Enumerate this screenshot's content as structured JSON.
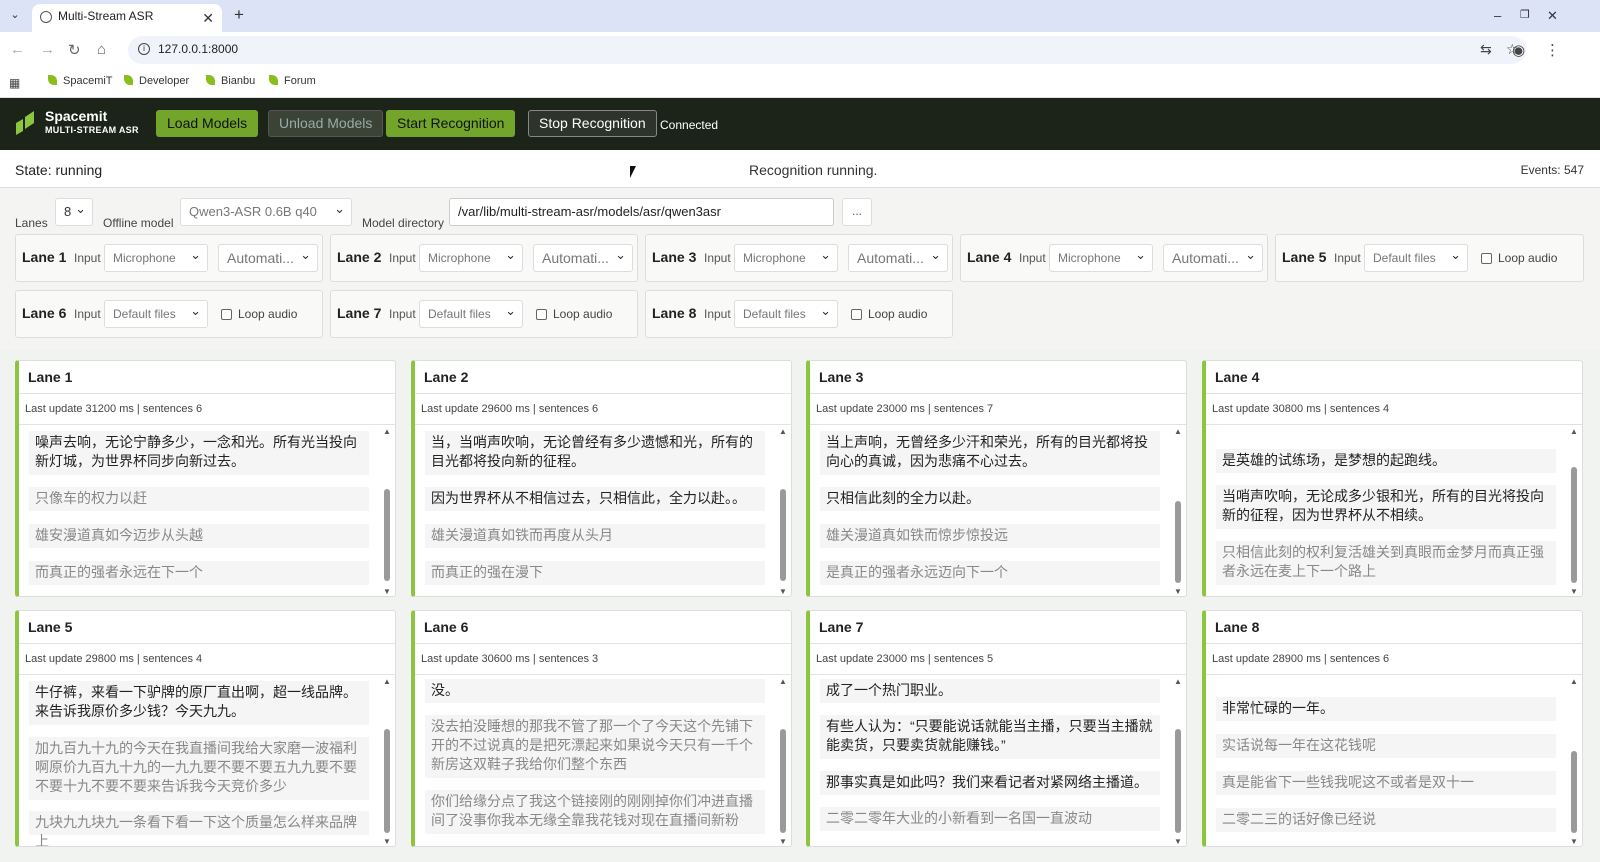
{
  "browser": {
    "tab_title": "Multi-Stream ASR",
    "url": "127.0.0.1:8000",
    "bookmarks": [
      "SpacemiT",
      "Developer",
      "Bianbu",
      "Forum"
    ]
  },
  "header": {
    "brand": "Spacemit",
    "brand_sub": "MULTI-STREAM ASR",
    "buttons": {
      "load": "Load Models",
      "unload": "Unload Models",
      "start": "Start Recognition",
      "stop": "Stop Recognition"
    },
    "connection": "Connected"
  },
  "status": {
    "state": "State: running",
    "message": "Recognition running.",
    "events": "Events: 547"
  },
  "config": {
    "lanes_label": "Lanes",
    "lanes_value": "8",
    "offline_model_label": "Offline model",
    "offline_model_value": "Qwen3-ASR 0.6B q40",
    "model_dir_label": "Model directory",
    "model_dir_value": "/var/lib/multi-stream-asr/models/asr/qwen3asr",
    "browse": "...",
    "input_label": "Input",
    "loop_label": "Loop audio",
    "lane_controls": [
      {
        "title": "Lane 1",
        "input": "Microphone",
        "mode": "Automati..."
      },
      {
        "title": "Lane 2",
        "input": "Microphone",
        "mode": "Automati..."
      },
      {
        "title": "Lane 3",
        "input": "Microphone",
        "mode": "Automati..."
      },
      {
        "title": "Lane 4",
        "input": "Microphone",
        "mode": "Automati..."
      },
      {
        "title": "Lane 5",
        "input": "Default files"
      },
      {
        "title": "Lane 6",
        "input": "Default files"
      },
      {
        "title": "Lane 7",
        "input": "Default files"
      },
      {
        "title": "Lane 8",
        "input": "Default files"
      }
    ]
  },
  "lanes": [
    {
      "title": "Lane 1",
      "meta": "Last update 31200 ms | sentences 6",
      "segments": [
        {
          "text": "噪声去响，无论宁静多少，一念和光。所有光当投向新灯城，为世界杯同步向新过去。",
          "final": true
        },
        {
          "text": "只像车的权力以赶",
          "final": false
        },
        {
          "text": "雄安漫道真如今迈步从头越",
          "final": false
        },
        {
          "text": "而真正的强者永远在下一个",
          "final": false
        }
      ]
    },
    {
      "title": "Lane 2",
      "meta": "Last update 29600 ms | sentences 6",
      "segments": [
        {
          "text": "当，当哨声吹响，无论曾经有多少遗憾和光，所有的目光都将投向新的征程。",
          "final": true
        },
        {
          "text": "因为世界杯从不相信过去，只相信此，全力以赴。。",
          "final": true
        },
        {
          "text": "雄关漫道真如铁而再度从头月",
          "final": false
        },
        {
          "text": "而真正的强在漫下",
          "final": false
        }
      ]
    },
    {
      "title": "Lane 3",
      "meta": "Last update 23000 ms | sentences 7",
      "segments": [
        {
          "text": "当上声响，无曾经多少汗和荣光，所有的目光都将投向心的真诚，因为悲痛不心过去。",
          "final": true
        },
        {
          "text": "只相信此刻的全力以赴。",
          "final": true
        },
        {
          "text": "雄关漫道真如铁而惊步惊投远",
          "final": false
        },
        {
          "text": "是真正的强者永远迈向下一个",
          "final": false
        }
      ]
    },
    {
      "title": "Lane 4",
      "meta": "Last update 30800 ms | sentences 4",
      "segments": [
        {
          "text": "是英雄的试练场，是梦想的起跑线。",
          "final": true
        },
        {
          "text": "当哨声吹响，无论成多少银和光，所有的目光将投向新的征程，因为世界杯从不相续。",
          "final": true
        },
        {
          "text": "只相信此刻的权利复活雄关到真眼而金梦月而真正强者永远在麦上下一个路上",
          "final": false
        }
      ]
    },
    {
      "title": "Lane 5",
      "meta": "Last update 29800 ms | sentences 4",
      "segments": [
        {
          "text": "牛仔裤，来看一下驴牌的原厂直出啊，超一线品牌。来告诉我原价多少钱？今天九九。",
          "final": true
        },
        {
          "text": "加九百九十九的今天在我直播间我给大家磨一波福利啊原价九百九十九的一九九要不要不要五九九要不要不要十九不要不要来告诉我今天竞价多少",
          "final": false
        },
        {
          "text": "九块九九块九一条看下看一下这个质量怎么样来品牌上",
          "final": false
        }
      ]
    },
    {
      "title": "Lane 6",
      "meta": "Last update 30600 ms | sentences 3",
      "segments": [
        {
          "text": "没。",
          "final": true
        },
        {
          "text": "没去拍没睡想的那我不管了那一个了今天这个先铺下开的不过说真的是把死漂起来如果说今天只有一千个新房这双鞋子我给你们整个东西",
          "final": false
        },
        {
          "text": "你们给缘分点了我这个链接刚的刚刚掉你们冲进直播间了没事你我本无缘全靠我花钱对现在直播间新粉",
          "final": false
        }
      ]
    },
    {
      "title": "Lane 7",
      "meta": "Last update 23000 ms | sentences 5",
      "segments": [
        {
          "text": "成了一个热门职业。",
          "final": true
        },
        {
          "text": "有些人认为：“只要能说话就能当主播，只要当主播就能卖货，只要卖货就能赚钱。”",
          "final": true
        },
        {
          "text": "那事实真是如此吗？我们来看记者对紧网络主播道。",
          "final": true
        },
        {
          "text": "二零二零年大业的小新看到一名国一直波动",
          "final": false
        }
      ]
    },
    {
      "title": "Lane 8",
      "meta": "Last update 28900 ms | sentences 6",
      "segments": [
        {
          "text": "非常忙碌的一年。",
          "final": true
        },
        {
          "text": "实话说每一年在这花钱呢",
          "final": false
        },
        {
          "text": "真是能省下一些钱我呢这不或者是双十一",
          "final": false
        },
        {
          "text": "二零二三的话好像已经说",
          "final": false
        }
      ]
    }
  ]
}
